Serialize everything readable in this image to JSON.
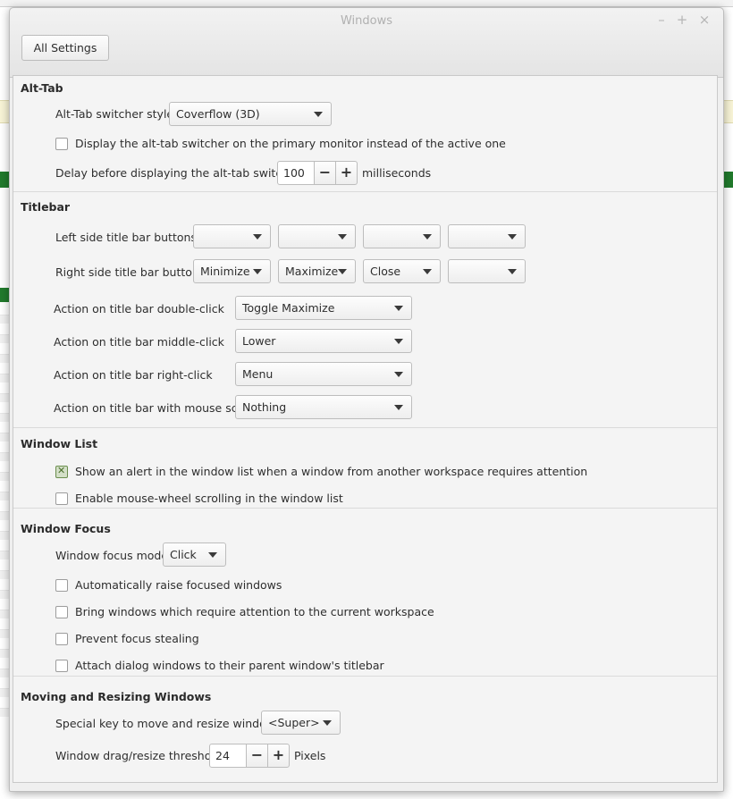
{
  "window": {
    "title": "Windows",
    "all_settings_label": "All Settings"
  },
  "sections": {
    "alt_tab": {
      "title": "Alt-Tab",
      "switcher_style_label": "Alt-Tab switcher style",
      "switcher_style_value": "Coverflow (3D)",
      "primary_monitor_label": "Display the alt-tab switcher on the primary monitor instead of the active one",
      "primary_monitor_checked": false,
      "delay_label": "Delay before displaying the alt-tab switcher",
      "delay_value": "100",
      "delay_unit": "milliseconds"
    },
    "titlebar": {
      "title": "Titlebar",
      "left_buttons_label": "Left side title bar buttons",
      "left_buttons": [
        "",
        "",
        "",
        ""
      ],
      "right_buttons_label": "Right side title bar buttons",
      "right_buttons": [
        "Minimize",
        "Maximize",
        "Close",
        ""
      ],
      "double_click_label": "Action on title bar double-click",
      "double_click_value": "Toggle Maximize",
      "middle_click_label": "Action on title bar middle-click",
      "middle_click_value": "Lower",
      "right_click_label": "Action on title bar right-click",
      "right_click_value": "Menu",
      "scroll_label": "Action on title bar with mouse scroll",
      "scroll_value": "Nothing"
    },
    "window_list": {
      "title": "Window List",
      "alert_label": "Show an alert in the window list when a window from another workspace requires attention",
      "alert_checked": true,
      "scroll_label": "Enable mouse-wheel scrolling in the window list",
      "scroll_checked": false
    },
    "window_focus": {
      "title": "Window Focus",
      "focus_mode_label": "Window focus mode",
      "focus_mode_value": "Click",
      "auto_raise_label": "Automatically raise focused windows",
      "attention_label": "Bring windows which require attention to the current workspace",
      "prevent_stealing_label": "Prevent focus stealing",
      "attach_dialogs_label": "Attach dialog windows to their parent window's titlebar"
    },
    "moving_resizing": {
      "title": "Moving and Resizing Windows",
      "special_key_label": "Special key to move and resize windows",
      "special_key_value": "<Super>",
      "threshold_label": "Window drag/resize threshold",
      "threshold_value": "24",
      "threshold_unit": "Pixels"
    }
  },
  "icons": {
    "minimize": "–",
    "maximize": "+",
    "close": "×",
    "spin_minus": "−",
    "spin_plus": "+"
  },
  "colors": {
    "checked_fill": "#d3dfc7",
    "checked_mark": "#4a6f2b",
    "green_bar": "#217a2c"
  }
}
